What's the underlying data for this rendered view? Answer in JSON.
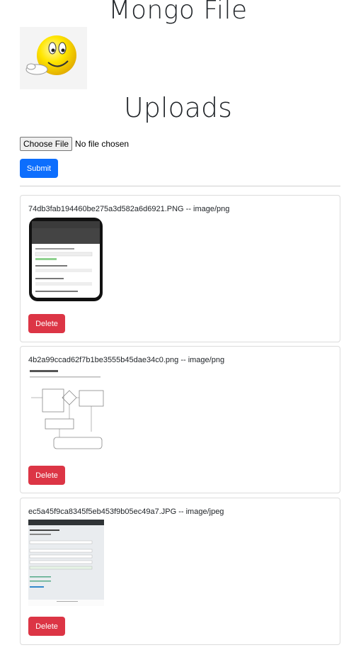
{
  "app": {
    "title": "Mongo File"
  },
  "logo": {
    "icon": "smiley-logo-icon"
  },
  "uploads": {
    "heading": "Uploads"
  },
  "upload_form": {
    "choose_label": "Choose File",
    "file_status": "No file chosen",
    "submit_label": "Submit"
  },
  "files": [
    {
      "name": "74db3fab194460be275a3d582a6d6921.PNG -- image/png",
      "delete_label": "Delete"
    },
    {
      "name": "4b2a99ccad62f7b1be3555b45dae34c0.png -- image/png",
      "delete_label": "Delete"
    },
    {
      "name": "ec5a45f9ca8345f5eb453f9b05ec49a7.JPG -- image/jpeg",
      "delete_label": "Delete"
    }
  ],
  "colors": {
    "primary": "#0d6efd",
    "danger": "#dc3545"
  }
}
